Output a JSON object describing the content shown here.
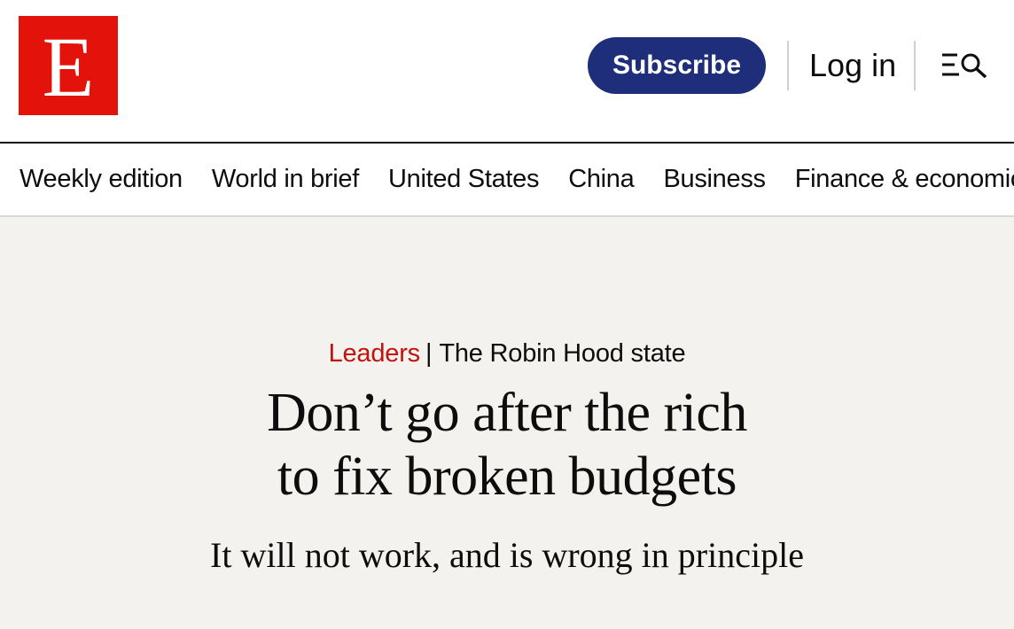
{
  "header": {
    "logo_letter": "E",
    "subscribe_label": "Subscribe",
    "login_label": "Log in",
    "menu_icon": "menu-search-icon"
  },
  "nav": {
    "items": [
      {
        "label": "Weekly edition"
      },
      {
        "label": "World in brief"
      },
      {
        "label": "United States"
      },
      {
        "label": "China"
      },
      {
        "label": "Business"
      },
      {
        "label": "Finance & economics"
      }
    ]
  },
  "article": {
    "section": "Leaders",
    "separator": "|",
    "topic": "The Robin Hood state",
    "headline_line1": "Don’t go after the rich",
    "headline_line2": "to fix broken budgets",
    "subheadline": "It will not work, and is wrong in principle"
  },
  "colors": {
    "brand_red": "#e3120b",
    "subscribe_blue": "#1f2e7a",
    "section_red": "#c3120b",
    "page_background": "#f3f2ee"
  }
}
